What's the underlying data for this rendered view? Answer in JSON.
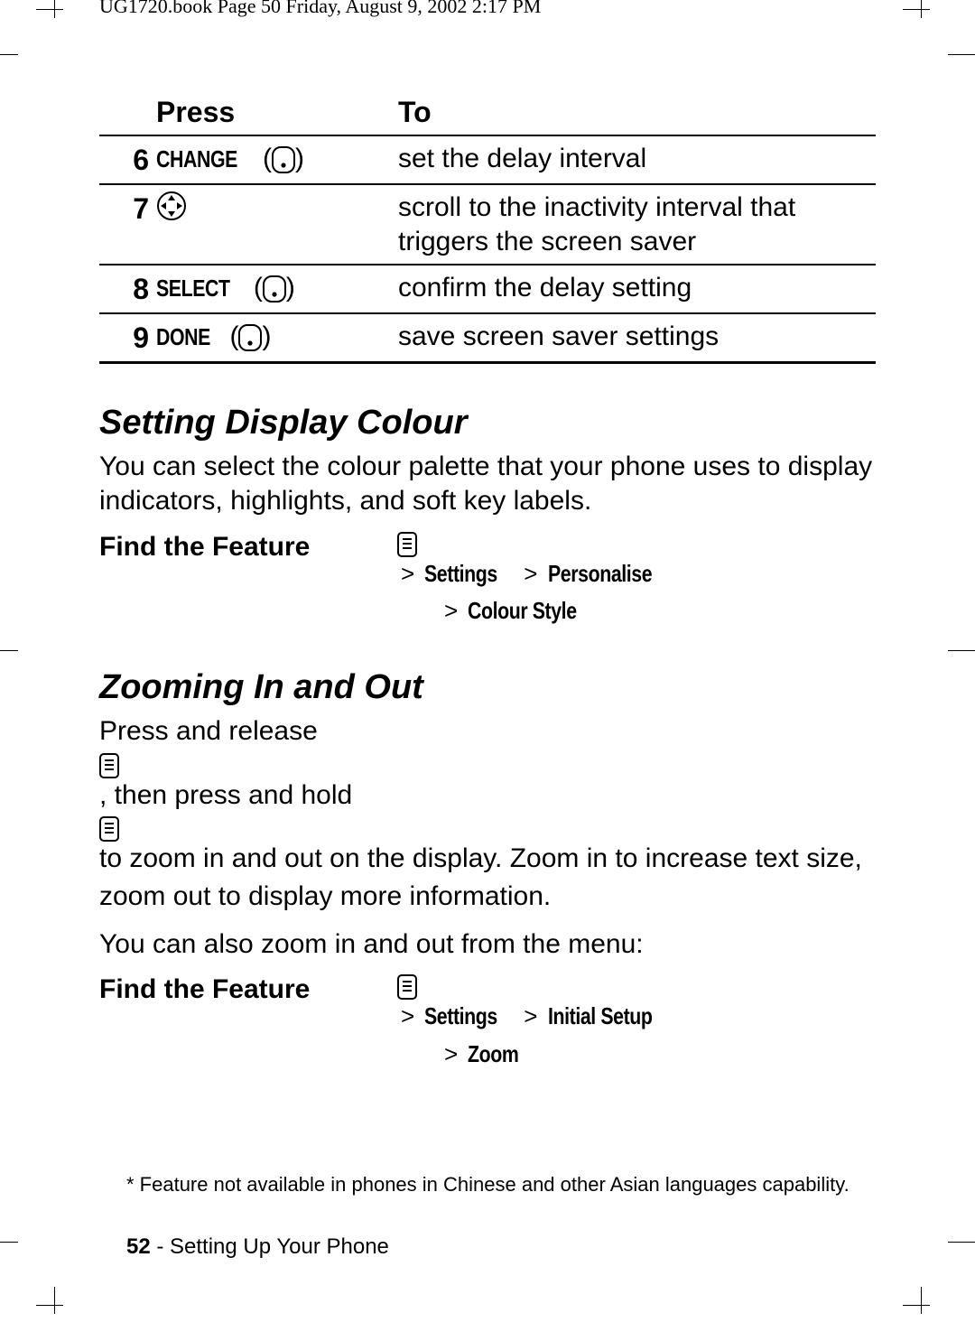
{
  "meta": {
    "crop_header": "UG1720.book  Page 50  Friday, August 9, 2002  2:17 PM"
  },
  "table": {
    "headers": {
      "press": "Press",
      "to": "To"
    },
    "rows": [
      {
        "n": "6",
        "cmd": "CHANGE",
        "icon": "softkey",
        "to": "set the delay interval"
      },
      {
        "n": "7",
        "cmd": "",
        "icon": "nav",
        "to": "scroll to the inactivity interval that triggers the screen saver"
      },
      {
        "n": "8",
        "cmd": "SELECT",
        "icon": "softkey",
        "to": "confirm the delay setting"
      },
      {
        "n": "9",
        "cmd": "DONE",
        "icon": "softkey",
        "to": "save screen saver settings"
      }
    ]
  },
  "section1": {
    "heading": "Setting Display Colour",
    "body": "You can select the colour palette that your phone uses to display indicators, highlights, and soft key labels.",
    "feature_label": "Find the Feature",
    "path_line1_a": "Settings",
    "path_line1_b": "Personalise",
    "path_line2": "Colour Style"
  },
  "section2": {
    "heading": "Zooming In and Out",
    "body1_a": "Press and release ",
    "body1_b": ", then press and hold ",
    "body1_c": " to zoom in and out on the display. Zoom in to increase text size, zoom out to display more information.",
    "body2": "You can also zoom in and out from the menu:",
    "feature_label": "Find the Feature",
    "path_line1_a": "Settings",
    "path_line1_b": "Initial Setup",
    "path_line2": "Zoom"
  },
  "footnote": "* Feature not available in phones in Chinese and other Asian languages capability.",
  "footer": {
    "page": "52",
    "sep": " - ",
    "title": "Setting Up Your Phone"
  },
  "glyphs": {
    "gt": ">"
  }
}
